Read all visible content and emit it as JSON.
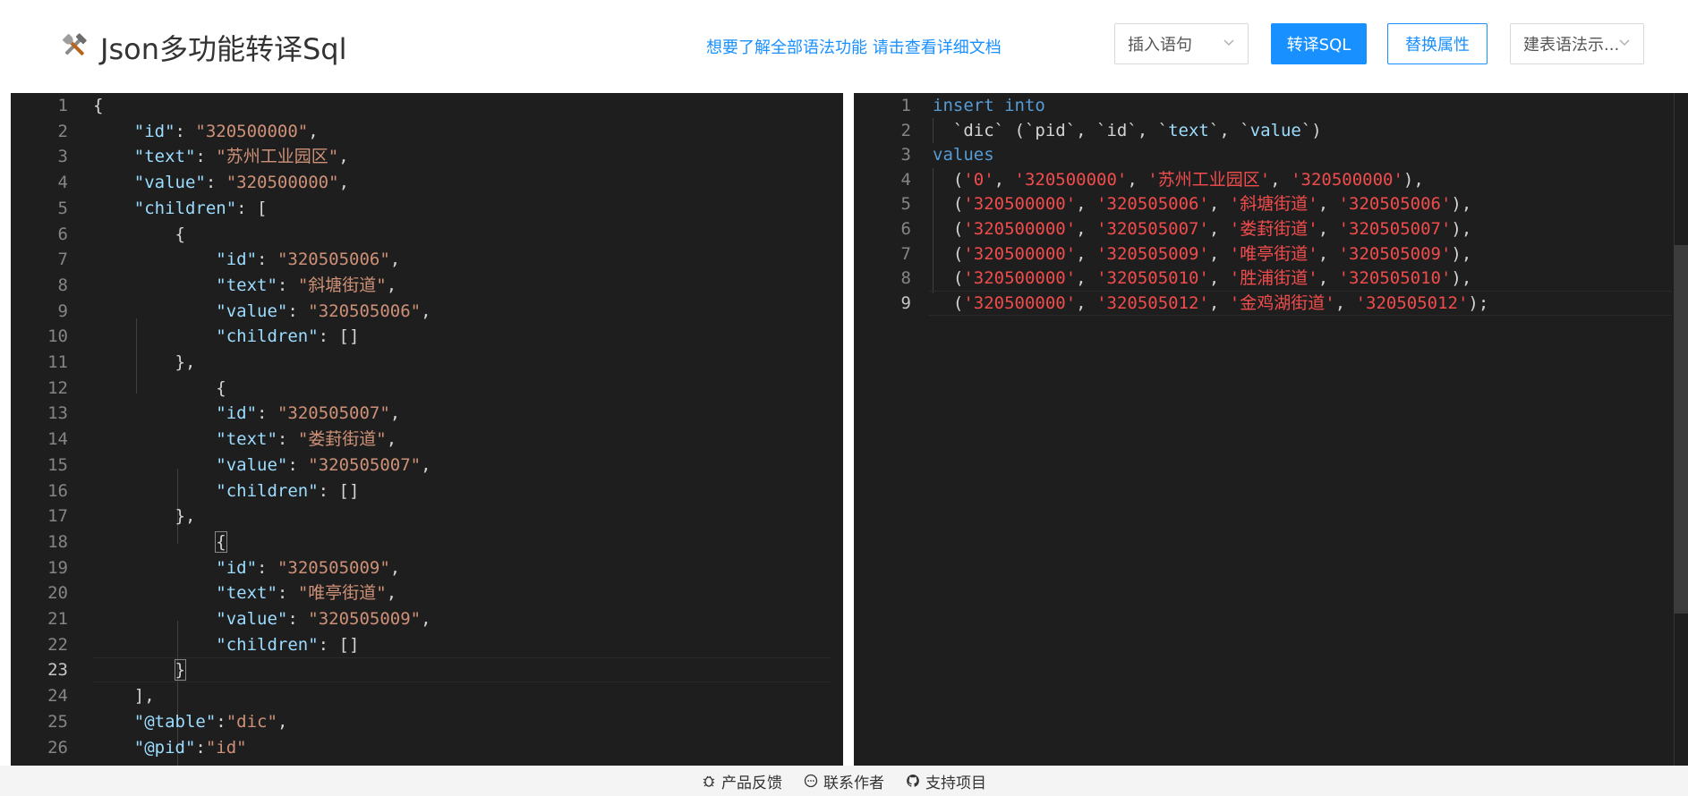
{
  "header": {
    "title": "Json多功能转译Sql",
    "doc_link": "想要了解全部语法功能 请击查看详细文档",
    "insert_select": "插入语句",
    "convert_button": "转译SQL",
    "replace_button": "替换属性",
    "ddl_select": "建表语法示..."
  },
  "json_editor": {
    "lines": [
      [
        {
          "t": "p",
          "v": "{"
        }
      ],
      [
        {
          "t": "p",
          "v": "    "
        },
        {
          "t": "k",
          "v": "\"id\""
        },
        {
          "t": "p",
          "v": ": "
        },
        {
          "t": "s",
          "v": "\"320500000\""
        },
        {
          "t": "p",
          "v": ","
        }
      ],
      [
        {
          "t": "p",
          "v": "    "
        },
        {
          "t": "k",
          "v": "\"text\""
        },
        {
          "t": "p",
          "v": ": "
        },
        {
          "t": "s",
          "v": "\"苏州工业园区\""
        },
        {
          "t": "p",
          "v": ","
        }
      ],
      [
        {
          "t": "p",
          "v": "    "
        },
        {
          "t": "k",
          "v": "\"value\""
        },
        {
          "t": "p",
          "v": ": "
        },
        {
          "t": "s",
          "v": "\"320500000\""
        },
        {
          "t": "p",
          "v": ","
        }
      ],
      [
        {
          "t": "p",
          "v": "    "
        },
        {
          "t": "k",
          "v": "\"children\""
        },
        {
          "t": "p",
          "v": ": ["
        }
      ],
      [
        {
          "t": "p",
          "v": "        {"
        }
      ],
      [
        {
          "t": "p",
          "v": "            "
        },
        {
          "t": "k",
          "v": "\"id\""
        },
        {
          "t": "p",
          "v": ": "
        },
        {
          "t": "s",
          "v": "\"320505006\""
        },
        {
          "t": "p",
          "v": ","
        }
      ],
      [
        {
          "t": "p",
          "v": "            "
        },
        {
          "t": "k",
          "v": "\"text\""
        },
        {
          "t": "p",
          "v": ": "
        },
        {
          "t": "s",
          "v": "\"斜塘街道\""
        },
        {
          "t": "p",
          "v": ","
        }
      ],
      [
        {
          "t": "p",
          "v": "            "
        },
        {
          "t": "k",
          "v": "\"value\""
        },
        {
          "t": "p",
          "v": ": "
        },
        {
          "t": "s",
          "v": "\"320505006\""
        },
        {
          "t": "p",
          "v": ","
        }
      ],
      [
        {
          "t": "p",
          "v": "            "
        },
        {
          "t": "k",
          "v": "\"children\""
        },
        {
          "t": "p",
          "v": ": []"
        }
      ],
      [
        {
          "t": "p",
          "v": "        },"
        }
      ],
      [
        {
          "t": "p",
          "v": "            {"
        }
      ],
      [
        {
          "t": "p",
          "v": "            "
        },
        {
          "t": "k",
          "v": "\"id\""
        },
        {
          "t": "p",
          "v": ": "
        },
        {
          "t": "s",
          "v": "\"320505007\""
        },
        {
          "t": "p",
          "v": ","
        }
      ],
      [
        {
          "t": "p",
          "v": "            "
        },
        {
          "t": "k",
          "v": "\"text\""
        },
        {
          "t": "p",
          "v": ": "
        },
        {
          "t": "s",
          "v": "\"娄葑街道\""
        },
        {
          "t": "p",
          "v": ","
        }
      ],
      [
        {
          "t": "p",
          "v": "            "
        },
        {
          "t": "k",
          "v": "\"value\""
        },
        {
          "t": "p",
          "v": ": "
        },
        {
          "t": "s",
          "v": "\"320505007\""
        },
        {
          "t": "p",
          "v": ","
        }
      ],
      [
        {
          "t": "p",
          "v": "            "
        },
        {
          "t": "k",
          "v": "\"children\""
        },
        {
          "t": "p",
          "v": ": []"
        }
      ],
      [
        {
          "t": "p",
          "v": "        },"
        }
      ],
      [
        {
          "t": "p",
          "v": "            "
        },
        {
          "t": "b",
          "v": "{"
        }
      ],
      [
        {
          "t": "p",
          "v": "            "
        },
        {
          "t": "k",
          "v": "\"id\""
        },
        {
          "t": "p",
          "v": ": "
        },
        {
          "t": "s",
          "v": "\"320505009\""
        },
        {
          "t": "p",
          "v": ","
        }
      ],
      [
        {
          "t": "p",
          "v": "            "
        },
        {
          "t": "k",
          "v": "\"text\""
        },
        {
          "t": "p",
          "v": ": "
        },
        {
          "t": "s",
          "v": "\"唯亭街道\""
        },
        {
          "t": "p",
          "v": ","
        }
      ],
      [
        {
          "t": "p",
          "v": "            "
        },
        {
          "t": "k",
          "v": "\"value\""
        },
        {
          "t": "p",
          "v": ": "
        },
        {
          "t": "s",
          "v": "\"320505009\""
        },
        {
          "t": "p",
          "v": ","
        }
      ],
      [
        {
          "t": "p",
          "v": "            "
        },
        {
          "t": "k",
          "v": "\"children\""
        },
        {
          "t": "p",
          "v": ": []"
        }
      ],
      [
        {
          "t": "p",
          "v": "        "
        },
        {
          "t": "b",
          "v": "}"
        }
      ],
      [
        {
          "t": "p",
          "v": "    ],"
        }
      ],
      [
        {
          "t": "p",
          "v": "    "
        },
        {
          "t": "k",
          "v": "\"@table\""
        },
        {
          "t": "p",
          "v": ":"
        },
        {
          "t": "s",
          "v": "\"dic\""
        },
        {
          "t": "p",
          "v": ","
        }
      ],
      [
        {
          "t": "p",
          "v": "    "
        },
        {
          "t": "k",
          "v": "\"@pid\""
        },
        {
          "t": "p",
          "v": ":"
        },
        {
          "t": "s",
          "v": "\"id\""
        }
      ]
    ],
    "active_line": 23
  },
  "sql_editor": {
    "lines": [
      [
        {
          "t": "kw",
          "v": "insert into"
        }
      ],
      [
        {
          "t": "p",
          "v": "  `dic` (`pid`, `id`, `"
        },
        {
          "t": "k",
          "v": "text"
        },
        {
          "t": "p",
          "v": "`, `"
        },
        {
          "t": "k",
          "v": "value"
        },
        {
          "t": "p",
          "v": "`)"
        }
      ],
      [
        {
          "t": "kw",
          "v": "values"
        }
      ],
      [
        {
          "t": "p",
          "v": "  ("
        },
        {
          "t": "sr",
          "v": "'0'"
        },
        {
          "t": "p",
          "v": ", "
        },
        {
          "t": "sr",
          "v": "'320500000'"
        },
        {
          "t": "p",
          "v": ", "
        },
        {
          "t": "sr",
          "v": "'苏州工业园区'"
        },
        {
          "t": "p",
          "v": ", "
        },
        {
          "t": "sr",
          "v": "'320500000'"
        },
        {
          "t": "p",
          "v": "),"
        }
      ],
      [
        {
          "t": "p",
          "v": "  ("
        },
        {
          "t": "sr",
          "v": "'320500000'"
        },
        {
          "t": "p",
          "v": ", "
        },
        {
          "t": "sr",
          "v": "'320505006'"
        },
        {
          "t": "p",
          "v": ", "
        },
        {
          "t": "sr",
          "v": "'斜塘街道'"
        },
        {
          "t": "p",
          "v": ", "
        },
        {
          "t": "sr",
          "v": "'320505006'"
        },
        {
          "t": "p",
          "v": "),"
        }
      ],
      [
        {
          "t": "p",
          "v": "  ("
        },
        {
          "t": "sr",
          "v": "'320500000'"
        },
        {
          "t": "p",
          "v": ", "
        },
        {
          "t": "sr",
          "v": "'320505007'"
        },
        {
          "t": "p",
          "v": ", "
        },
        {
          "t": "sr",
          "v": "'娄葑街道'"
        },
        {
          "t": "p",
          "v": ", "
        },
        {
          "t": "sr",
          "v": "'320505007'"
        },
        {
          "t": "p",
          "v": "),"
        }
      ],
      [
        {
          "t": "p",
          "v": "  ("
        },
        {
          "t": "sr",
          "v": "'320500000'"
        },
        {
          "t": "p",
          "v": ", "
        },
        {
          "t": "sr",
          "v": "'320505009'"
        },
        {
          "t": "p",
          "v": ", "
        },
        {
          "t": "sr",
          "v": "'唯亭街道'"
        },
        {
          "t": "p",
          "v": ", "
        },
        {
          "t": "sr",
          "v": "'320505009'"
        },
        {
          "t": "p",
          "v": "),"
        }
      ],
      [
        {
          "t": "p",
          "v": "  ("
        },
        {
          "t": "sr",
          "v": "'320500000'"
        },
        {
          "t": "p",
          "v": ", "
        },
        {
          "t": "sr",
          "v": "'320505010'"
        },
        {
          "t": "p",
          "v": ", "
        },
        {
          "t": "sr",
          "v": "'胜浦街道'"
        },
        {
          "t": "p",
          "v": ", "
        },
        {
          "t": "sr",
          "v": "'320505010'"
        },
        {
          "t": "p",
          "v": "),"
        }
      ],
      [
        {
          "t": "p",
          "v": "  ("
        },
        {
          "t": "sr",
          "v": "'320500000'"
        },
        {
          "t": "p",
          "v": ", "
        },
        {
          "t": "sr",
          "v": "'320505012'"
        },
        {
          "t": "p",
          "v": ", "
        },
        {
          "t": "sr",
          "v": "'金鸡湖街道'"
        },
        {
          "t": "p",
          "v": ", "
        },
        {
          "t": "sr",
          "v": "'320505012'"
        },
        {
          "t": "p",
          "v": ");"
        }
      ]
    ],
    "active_line": 9
  },
  "footer": {
    "feedback": "产品反馈",
    "contact": "联系作者",
    "support": "支持项目"
  },
  "colors": {
    "accent": "#1890ff",
    "editor_bg": "#1e1e1e",
    "json_key": "#9cdcfe",
    "json_string": "#ce9178",
    "sql_keyword": "#569cd6",
    "sql_string": "#f14c4c"
  },
  "icons": [
    "tools-logo-icon",
    "chevron-down-icon",
    "bug-icon",
    "chat-icon",
    "github-icon"
  ]
}
